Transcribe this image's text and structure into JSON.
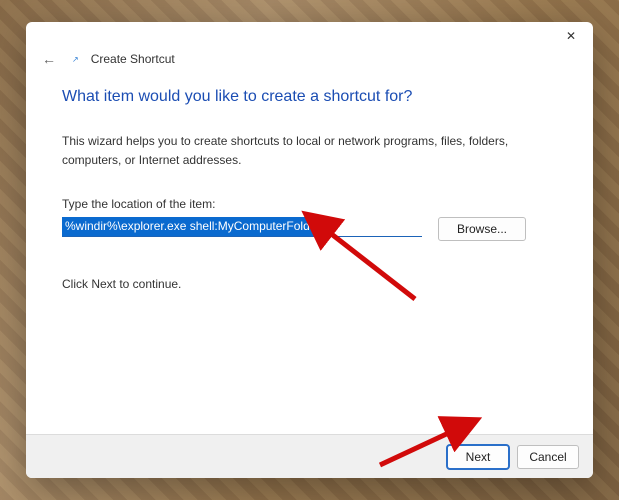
{
  "dialog": {
    "title": "Create Shortcut",
    "headline": "What item would you like to create a shortcut for?",
    "description": "This wizard helps you to create shortcuts to local or network programs, files, folders, computers, or Internet addresses.",
    "location_label": "Type the location of the item:",
    "location_value": "%windir%\\explorer.exe shell:MyComputerFolder",
    "browse_label": "Browse...",
    "continue_hint": "Click Next to continue.",
    "next_label": "Next",
    "cancel_label": "Cancel",
    "close_glyph": "✕",
    "back_glyph": "←"
  }
}
